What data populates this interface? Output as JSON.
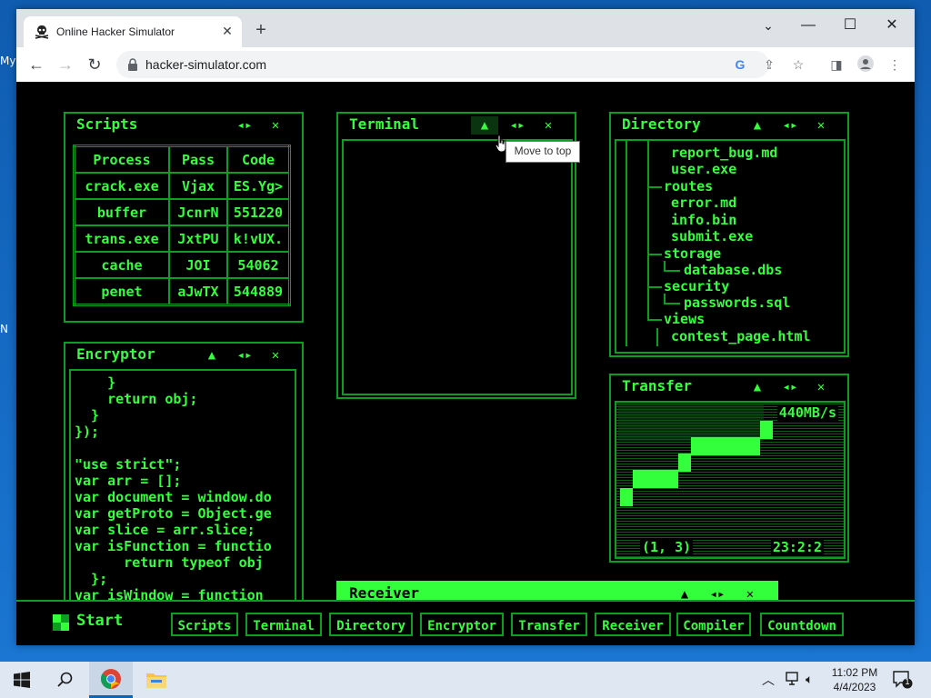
{
  "desktop": {
    "frag_top": "My",
    "frag_bottom": "N"
  },
  "browser": {
    "tab_title": "Online Hacker Simulator",
    "url": "hacker-simulator.com"
  },
  "scripts": {
    "title": "Scripts",
    "headers": [
      "Process",
      "Pass",
      "Code"
    ],
    "rows": [
      [
        "crack.exe",
        "Vjax",
        "ES.Yg>"
      ],
      [
        "buffer",
        "JcnrN",
        "551220"
      ],
      [
        "trans.exe",
        "JxtPU",
        "k!vUX."
      ],
      [
        "cache",
        "JOI",
        "54062"
      ],
      [
        "penet",
        "aJwTX",
        "544889"
      ]
    ]
  },
  "terminal": {
    "title": "Terminal",
    "tooltip": "Move to top"
  },
  "directory": {
    "title": "Directory",
    "lines": [
      "report_bug.md",
      "user.exe",
      "routes",
      "error.md",
      "info.bin",
      "submit.exe",
      "storage",
      "database.dbs",
      "security",
      "passwords.sql",
      "views",
      "contest_page.html"
    ]
  },
  "encryptor": {
    "title": "Encryptor",
    "lines": [
      "    }",
      "    return obj;",
      "  }",
      "});",
      "",
      "\"use strict\";",
      "var arr = [];",
      "var document = window.do",
      "var getProto = Object.ge",
      "var slice = arr.slice;",
      "var isFunction = functio",
      "      return typeof obj",
      "  };",
      "var isWindow = function"
    ]
  },
  "transfer": {
    "title": "Transfer",
    "speed": "440MB/s",
    "coords": "(1, 3)",
    "time": "23:2:2",
    "progress_steps": [
      1,
      2,
      4,
      5,
      7,
      8
    ]
  },
  "receiver": {
    "title": "Receiver"
  },
  "hackerbar": {
    "start": "Start",
    "buttons": [
      "Scripts",
      "Terminal",
      "Directory",
      "Encryptor",
      "Transfer",
      "Receiver",
      "Compiler",
      "Countdown"
    ]
  },
  "system": {
    "time": "11:02 PM",
    "date": "4/4/2023",
    "notif_count": "1"
  },
  "colors": {
    "green": "#34ff3c",
    "dark_green": "#0c9e20",
    "black": "#000000"
  }
}
